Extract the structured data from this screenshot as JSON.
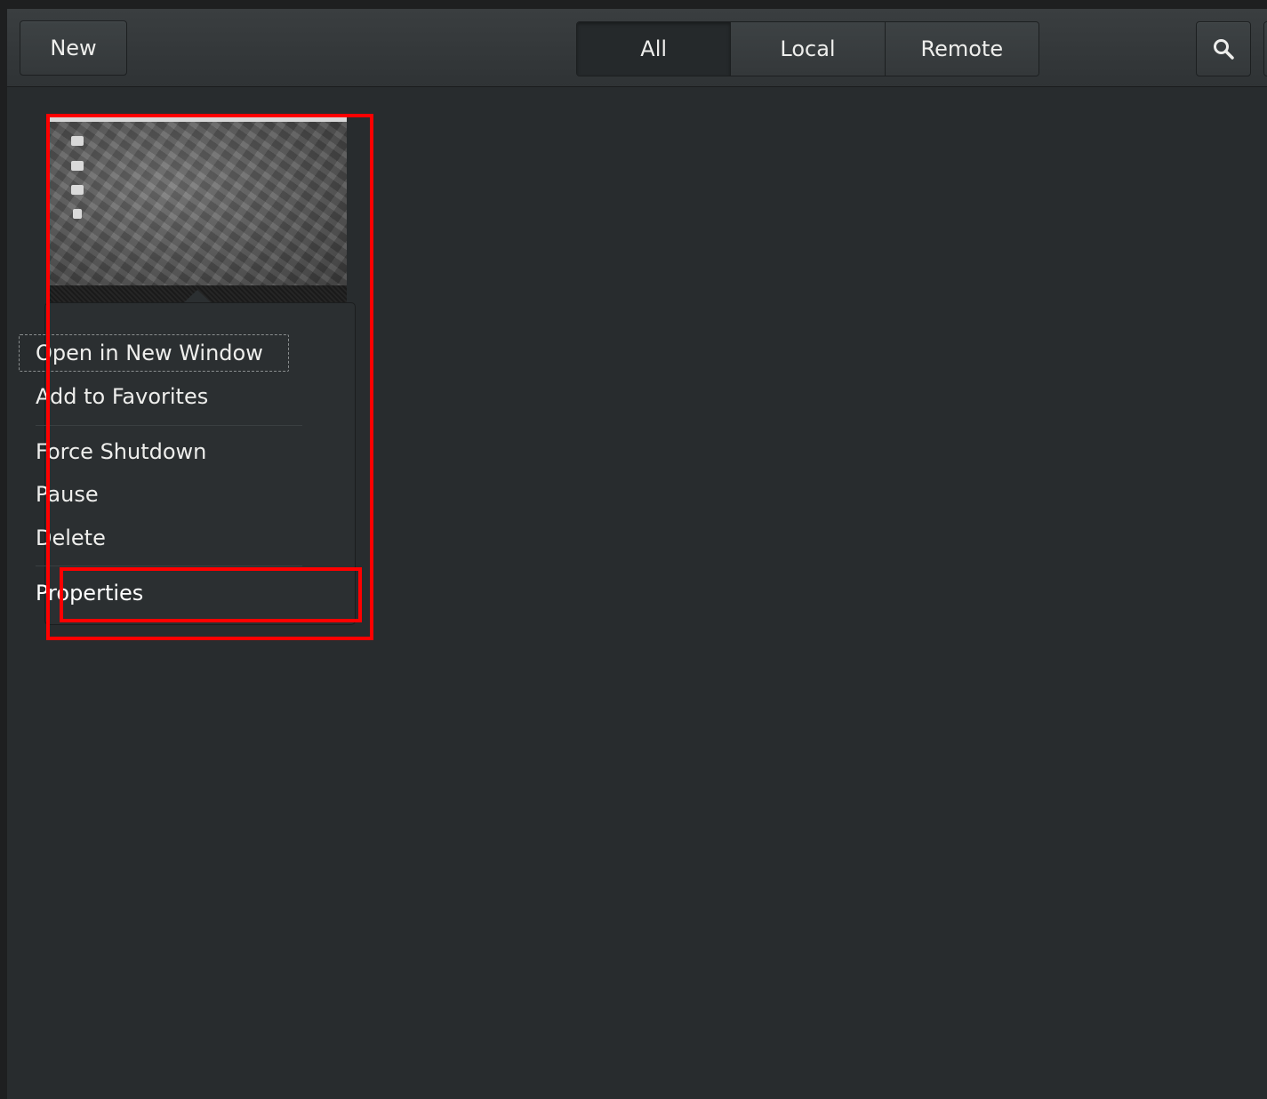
{
  "header": {
    "new_label": "New",
    "tabs": [
      {
        "label": "All",
        "active": true
      },
      {
        "label": "Local",
        "active": false
      },
      {
        "label": "Remote",
        "active": false
      }
    ],
    "search_icon": "search-icon"
  },
  "context_menu": {
    "items": [
      {
        "label": "Open in New Window"
      },
      {
        "label": "Add to Favorites"
      },
      {
        "label": "Force Shutdown"
      },
      {
        "label": "Pause"
      },
      {
        "label": "Delete"
      },
      {
        "label": "Properties"
      }
    ]
  },
  "colors": {
    "highlight": "#ff0000",
    "background": "#282c2e",
    "text": "#eeeeec"
  }
}
